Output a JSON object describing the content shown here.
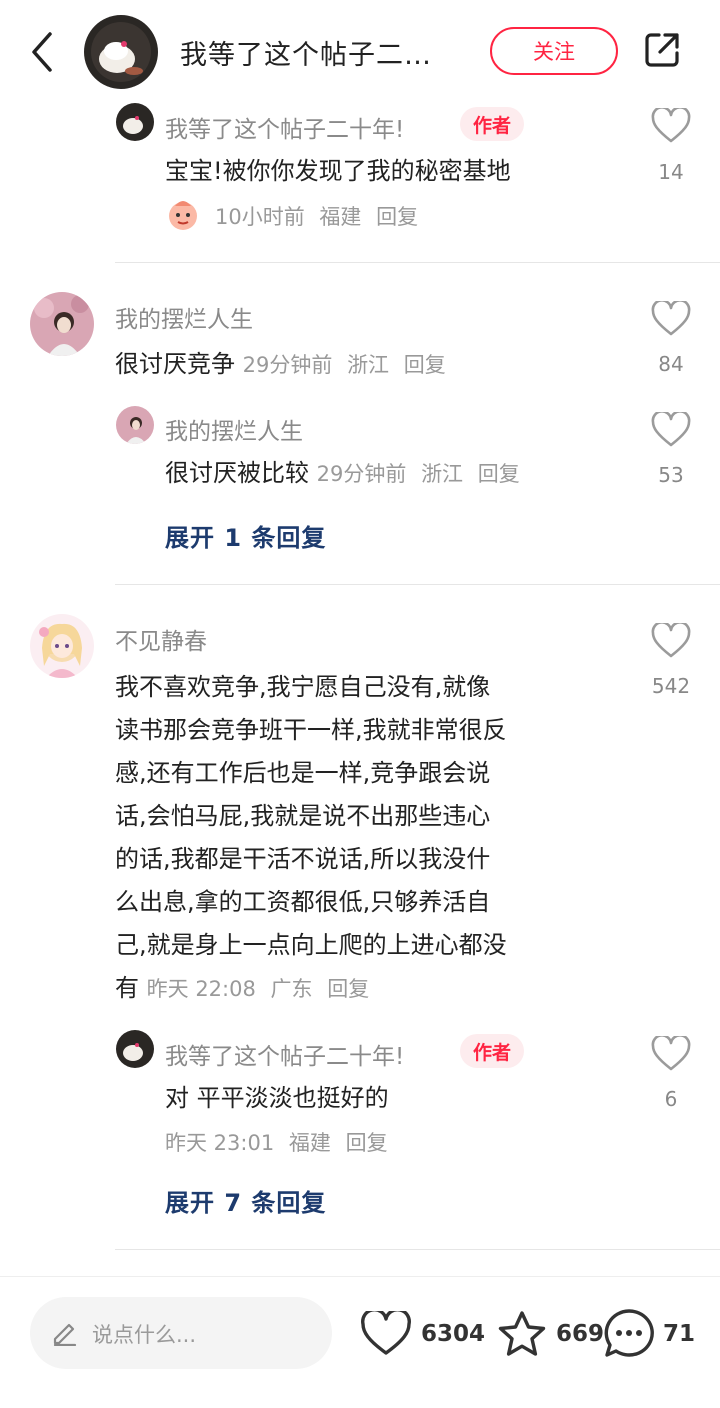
{
  "header": {
    "title": "我等了这个帖子二…",
    "follow_label": "关注"
  },
  "comments": [
    {
      "reply": {
        "name": "我等了这个帖子二十年!",
        "tag": "作者",
        "text": "宝宝!被你你发现了我的秘密基地",
        "time": "10小时前",
        "location": "福建",
        "reply_label": "回复",
        "likes": "14"
      }
    },
    {
      "name": "我的摆烂人生",
      "text": "很讨厌竞争",
      "time": "29分钟前",
      "location": "浙江",
      "reply_label": "回复",
      "likes": "84",
      "reply": {
        "name": "我的摆烂人生",
        "text": "很讨厌被比较",
        "time": "29分钟前",
        "location": "浙江",
        "reply_label": "回复",
        "likes": "53"
      },
      "expand_label": "展开 1 条回复"
    },
    {
      "name": "不见静春",
      "text_lines": [
        "我不喜欢竞争,我宁愿自己没有,就像",
        "读书那会竞争班干一样,我就非常很反",
        "感,还有工作后也是一样,竞争跟会说",
        "话,会怕马屁,我就是说不出那些违心",
        "的话,我都是干活不说话,所以我没什",
        "么出息,拿的工资都很低,只够养活自",
        "己,就是身上一点向上爬的上进心都没",
        "有"
      ],
      "time": "昨天 22:08",
      "location": "广东",
      "reply_label": "回复",
      "likes": "542",
      "reply": {
        "name": "我等了这个帖子二十年!",
        "tag": "作者",
        "text": "对 平平淡淡也挺好的",
        "time": "昨天 23:01",
        "location": "福建",
        "reply_label": "回复",
        "likes": "6"
      },
      "expand_label": "展开 7 条回复"
    }
  ],
  "bottom_bar": {
    "placeholder": "说点什么...",
    "likes": "6304",
    "favorites": "669",
    "comments": "71"
  },
  "colors": {
    "accent": "#ff2442",
    "expand_link": "#1d3b6e",
    "author_tag_bg": "#fdecee"
  },
  "icons": [
    "back-arrow-icon",
    "share-icon",
    "heart-icon",
    "star-icon",
    "comment-bubble-icon",
    "pencil-icon",
    "emoji-sticker-icon"
  ]
}
